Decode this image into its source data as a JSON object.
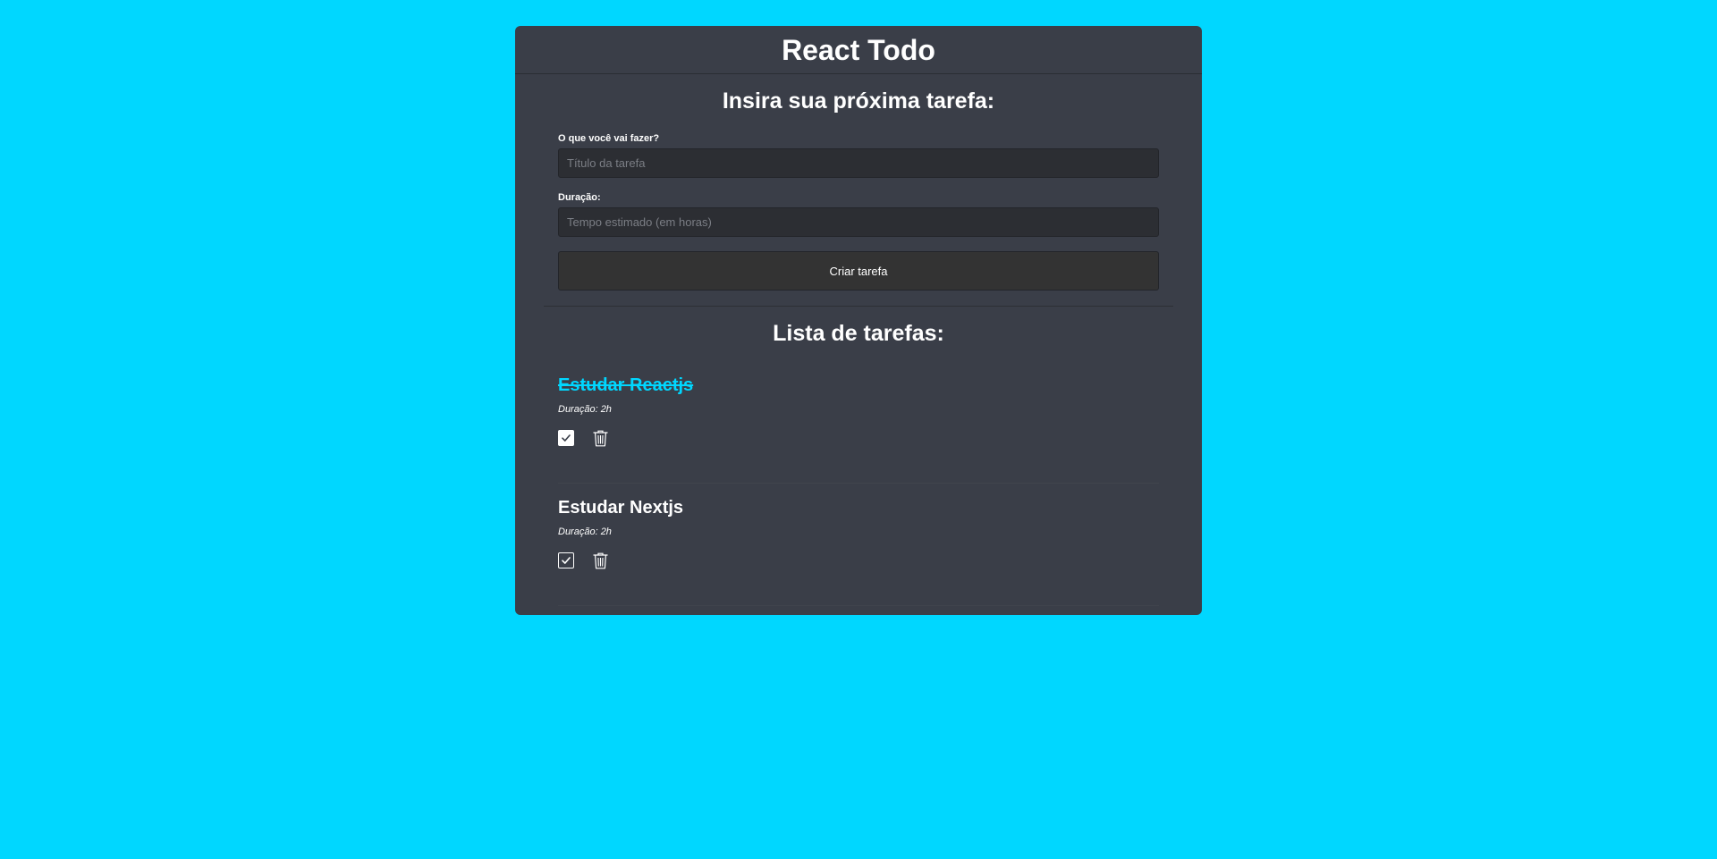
{
  "app": {
    "title": "React Todo"
  },
  "form": {
    "heading": "Insira sua próxima tarefa:",
    "title_field": {
      "label": "O que você vai fazer?",
      "placeholder": "Título da tarefa",
      "value": ""
    },
    "duration_field": {
      "label": "Duração:",
      "placeholder": "Tempo estimado (em horas)",
      "value": ""
    },
    "submit_label": "Criar tarefa"
  },
  "list": {
    "heading": "Lista de tarefas:",
    "tasks": [
      {
        "title": "Estudar Reactjs",
        "duration": "Duração: 2h",
        "done": true
      },
      {
        "title": "Estudar Nextjs",
        "duration": "Duração: 2h",
        "done": false
      }
    ]
  },
  "icons": {
    "check": "check-icon",
    "delete": "trash-icon"
  },
  "colors": {
    "background": "#00d7ff",
    "panel": "#3a3e48",
    "accent": "#00d7ff",
    "input": "#2c2e33",
    "button": "#333333"
  }
}
